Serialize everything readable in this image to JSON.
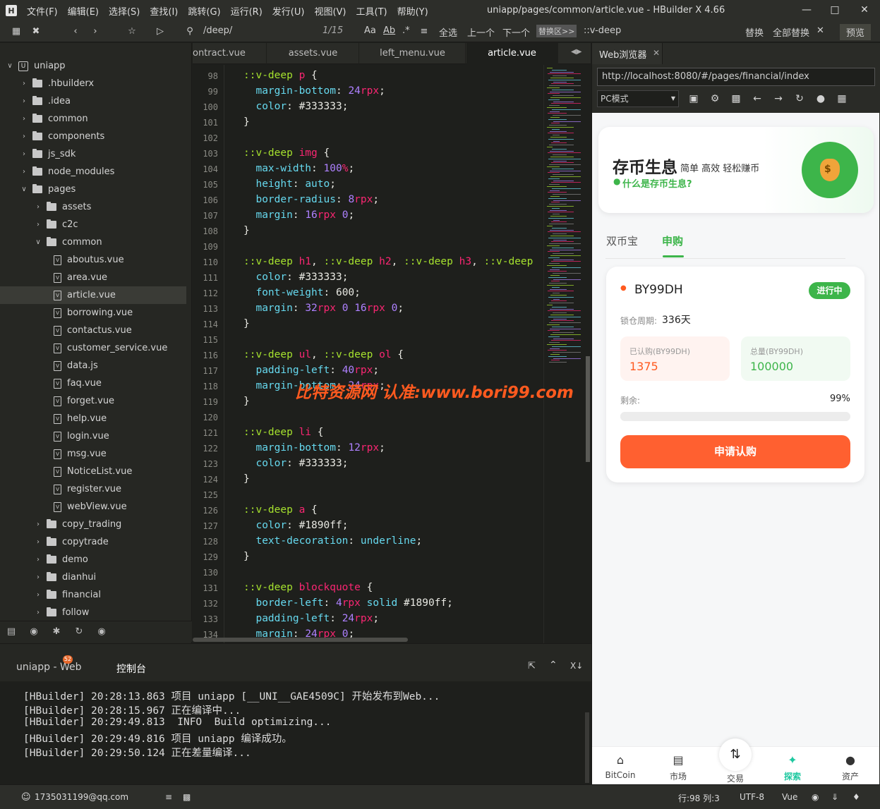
{
  "titlebar": {
    "app_icon": "H",
    "menu": [
      "文件(F)",
      "编辑(E)",
      "选择(S)",
      "查找(I)",
      "跳转(G)",
      "运行(R)",
      "发行(U)",
      "视图(V)",
      "工具(T)",
      "帮助(Y)"
    ],
    "title": "uniapp/pages/common/article.vue - HBuilder X 4.66"
  },
  "toolbar": {
    "search_text": "/deep/",
    "match_count": "1/15",
    "select_all": "全选",
    "prev": "上一个",
    "next": "下一个",
    "replace_area": "替换区>>",
    "replace_text": "::v-deep",
    "replace": "替换",
    "replace_all": "全部替换",
    "preview": "预览"
  },
  "sidebar": {
    "items": [
      {
        "label": "uniapp",
        "type": "project"
      },
      {
        "label": ".hbuilderx",
        "type": "folder"
      },
      {
        "label": ".idea",
        "type": "folder"
      },
      {
        "label": "common",
        "type": "folder"
      },
      {
        "label": "components",
        "type": "folder"
      },
      {
        "label": "js_sdk",
        "type": "folder"
      },
      {
        "label": "node_modules",
        "type": "folder"
      },
      {
        "label": "pages",
        "type": "folder"
      },
      {
        "label": "assets",
        "type": "folder"
      },
      {
        "label": "c2c",
        "type": "folder"
      },
      {
        "label": "common",
        "type": "folder"
      },
      {
        "label": "aboutus.vue",
        "type": "file"
      },
      {
        "label": "area.vue",
        "type": "file"
      },
      {
        "label": "article.vue",
        "type": "file"
      },
      {
        "label": "borrowing.vue",
        "type": "file"
      },
      {
        "label": "contactus.vue",
        "type": "file"
      },
      {
        "label": "customer_service.vue",
        "type": "file"
      },
      {
        "label": "data.js",
        "type": "file"
      },
      {
        "label": "faq.vue",
        "type": "file"
      },
      {
        "label": "forget.vue",
        "type": "file"
      },
      {
        "label": "help.vue",
        "type": "file"
      },
      {
        "label": "login.vue",
        "type": "file"
      },
      {
        "label": "msg.vue",
        "type": "file"
      },
      {
        "label": "NoticeList.vue",
        "type": "file"
      },
      {
        "label": "register.vue",
        "type": "file"
      },
      {
        "label": "webView.vue",
        "type": "file"
      },
      {
        "label": "copy_trading",
        "type": "folder"
      },
      {
        "label": "copytrade",
        "type": "folder"
      },
      {
        "label": "demo",
        "type": "folder"
      },
      {
        "label": "dianhui",
        "type": "folder"
      },
      {
        "label": "financial",
        "type": "folder"
      },
      {
        "label": "follow",
        "type": "folder"
      }
    ]
  },
  "editor": {
    "tabs": [
      "ontract.vue",
      "assets.vue",
      "left_menu.vue",
      "article.vue"
    ],
    "line_numbers": [
      "98",
      "99",
      "100",
      "101",
      "102",
      "103",
      "104",
      "105",
      "106",
      "107",
      "108",
      "109",
      "110",
      "111",
      "112",
      "113",
      "114",
      "115",
      "116",
      "117",
      "118",
      "119",
      "120",
      "121",
      "122",
      "123",
      "124",
      "125",
      "126",
      "127",
      "128",
      "129",
      "130",
      "131",
      "132",
      "133",
      "134"
    ],
    "lines": [
      "::v-deep p {",
      "  margin-bottom: 24rpx;",
      "  color: #333333;",
      "}",
      "",
      "::v-deep img {",
      "  max-width: 100%;",
      "  height: auto;",
      "  border-radius: 8rpx;",
      "  margin: 16rpx 0;",
      "}",
      "",
      "::v-deep h1, ::v-deep h2, ::v-deep h3, ::v-deep",
      "  color: #333333;",
      "  font-weight: 600;",
      "  margin: 32rpx 0 16rpx 0;",
      "}",
      "",
      "::v-deep ul, ::v-deep ol {",
      "  padding-left: 40rpx;",
      "  margin-bottom: 24rpx;",
      "}",
      "",
      "::v-deep li {",
      "  margin-bottom: 12rpx;",
      "  color: #333333;",
      "}",
      "",
      "::v-deep a {",
      "  color: #1890ff;",
      "  text-decoration: underline;",
      "}",
      "",
      "::v-deep blockquote {",
      "  border-left: 4rpx solid #1890ff;",
      "  padding-left: 24rpx;",
      "  margin: 24rpx 0;"
    ],
    "watermark": "比特资源网 认准:www.bori99.com"
  },
  "console": {
    "tab_web": "uniapp - Web",
    "badge": "52",
    "tab_console": "控制台",
    "logs": [
      "[HBuilder] 20:28:13.863 项目 uniapp [__UNI__GAE4509C] 开始发布到Web...",
      "[HBuilder] 20:28:15.967 正在编译中...",
      "[HBuilder] 20:29:49.813  INFO  Build optimizing...",
      "[HBuilder] 20:29:49.816 项目 uniapp 编译成功。",
      "[HBuilder] 20:29:50.124 正在差量编译..."
    ]
  },
  "statusbar": {
    "user": "1735031199@qq.com",
    "position": "行:98  列:3",
    "encoding": "UTF-8",
    "lang": "Vue"
  },
  "browser": {
    "tab": "Web浏览器",
    "url": "http://localhost:8080/#/pages/financial/index",
    "mode": "PC模式"
  },
  "phone": {
    "hero_title": "存币生息",
    "hero_sub": "简单 高效 轻松赚币",
    "hero_link": "什么是存币生息?",
    "tabs": [
      "双币宝",
      "申购"
    ],
    "product": {
      "name": "BY99DH",
      "status": "进行中",
      "lock_label": "锁仓周期:",
      "lock_value": "336天",
      "subscribed_label": "已认购(BY99DH)",
      "subscribed_value": "1375",
      "total_label": "总量(BY99DH)",
      "total_value": "100000",
      "remaining_label": "剩余:",
      "remaining_pct": "99%",
      "remaining_fraction": 0.99,
      "apply": "申请认购"
    },
    "nav": [
      "BitCoin",
      "市场",
      "交易",
      "探索",
      "资产"
    ],
    "colors": {
      "green": "#3db54a",
      "orange": "#ff5a1f",
      "teal": "#1ec8a0"
    }
  }
}
